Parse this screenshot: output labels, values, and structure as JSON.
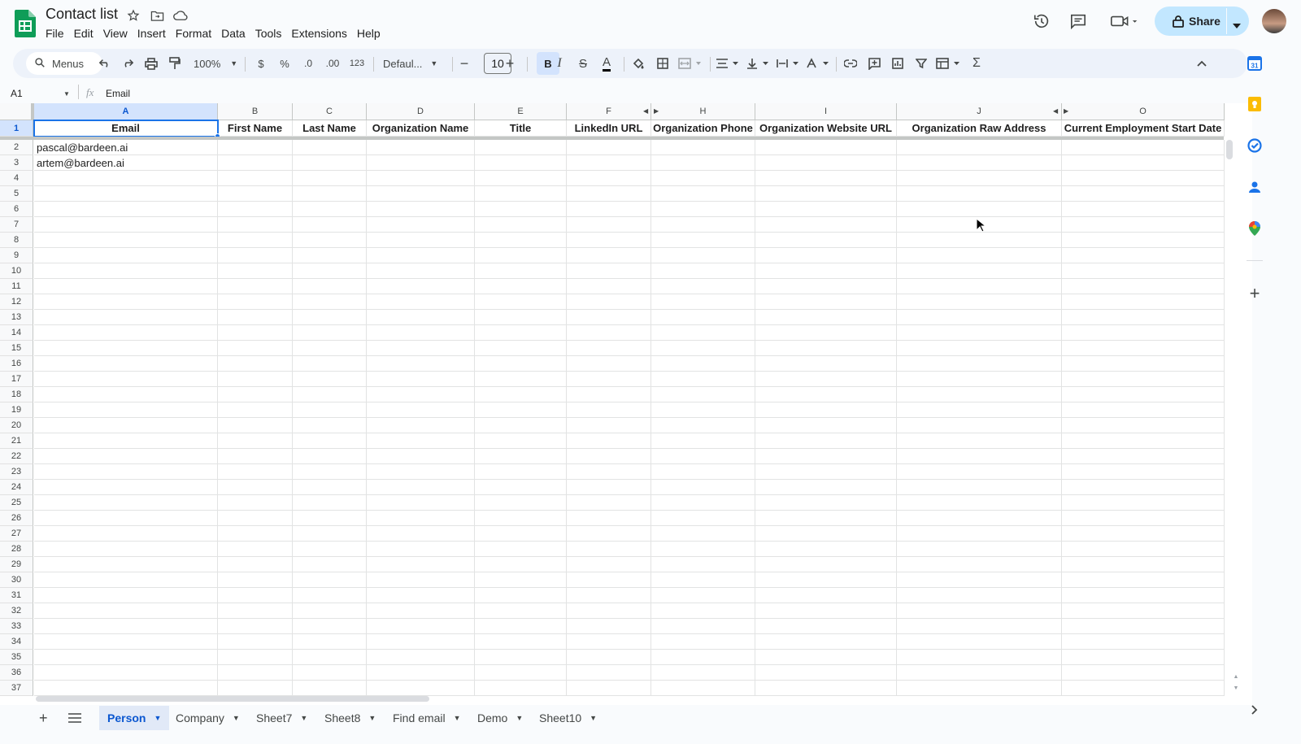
{
  "header": {
    "title": "Contact list",
    "menu": [
      "File",
      "Edit",
      "View",
      "Insert",
      "Format",
      "Data",
      "Tools",
      "Extensions",
      "Help"
    ],
    "share_label": "Share"
  },
  "toolbar": {
    "menus_label": "Menus",
    "zoom": "100%",
    "currency": "$",
    "percent": "%",
    "dec_less": ".0",
    "dec_more": ".00",
    "number_format": "123",
    "font": "Defaul...",
    "font_size": "10",
    "bold": "B",
    "italic": "I",
    "strike": "S",
    "text_color": "A",
    "sum": "Σ"
  },
  "formula_bar": {
    "name_box": "A1",
    "fx": "fx",
    "value": "Email"
  },
  "grid": {
    "columns": [
      "A",
      "B",
      "C",
      "D",
      "E",
      "F",
      "H",
      "I",
      "J",
      "O"
    ],
    "headers": [
      "Email",
      "First Name",
      "Last Name",
      "Organization Name",
      "Title",
      "LinkedIn URL",
      "Organization Phone",
      "Organization Website URL",
      "Organization Raw Address",
      "Current Employment Start Date"
    ],
    "rows": [
      [
        "pascal@bardeen.ai"
      ],
      [
        "artem@bardeen.ai"
      ]
    ],
    "row_numbers": [
      "1",
      "2",
      "3",
      "4",
      "5",
      "6",
      "7",
      "8",
      "9",
      "10",
      "11",
      "12",
      "13",
      "14",
      "15",
      "16",
      "17",
      "18",
      "19",
      "20",
      "21",
      "22",
      "23",
      "24",
      "25",
      "26",
      "27",
      "28",
      "29",
      "30",
      "31",
      "32",
      "33",
      "34",
      "35",
      "36",
      "37"
    ]
  },
  "sheet_tabs": {
    "tabs": [
      "Person",
      "Company",
      "Sheet7",
      "Sheet8",
      "Find email",
      "Demo",
      "Sheet10"
    ],
    "active": "Person"
  },
  "colors": {
    "accent": "#0b57d0",
    "share_bg": "#c2e7ff",
    "selection": "#1a73e8",
    "sheets_green": "#188038"
  }
}
